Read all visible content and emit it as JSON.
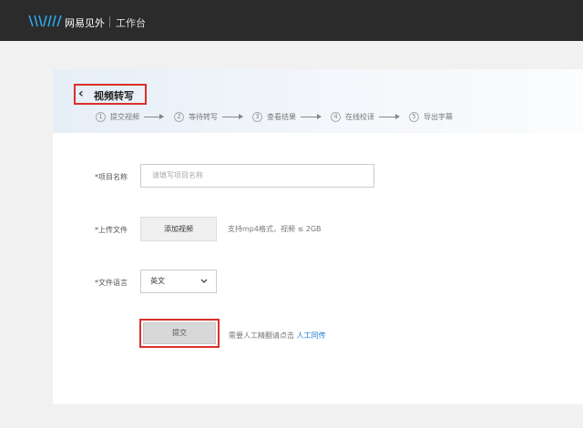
{
  "header": {
    "brand": "网易见外",
    "workspace": "工作台",
    "logo_icon": "waveform-logo"
  },
  "page": {
    "title": "视频转写",
    "back_icon": "chevron-left-icon"
  },
  "steps": [
    {
      "num": "1",
      "label": "提交视频"
    },
    {
      "num": "2",
      "label": "等待转写"
    },
    {
      "num": "3",
      "label": "查看结果"
    },
    {
      "num": "4",
      "label": "在线校译"
    },
    {
      "num": "5",
      "label": "导出字幕"
    }
  ],
  "form": {
    "project_label": "*项目名称",
    "project_placeholder": "请填写项目名称",
    "upload_label": "*上传文件",
    "upload_button": "添加视频",
    "upload_hint": "支持mp4格式，视频 ≤ 2GB",
    "language_label": "*文件语言",
    "language_value": "英文",
    "submit_button": "提交",
    "note_text": "需要人工精翻请点击",
    "note_link": "人工同传"
  },
  "colors": {
    "highlight": "#d9302a",
    "link": "#1e7ad9",
    "topbar": "#2b2b2b"
  }
}
